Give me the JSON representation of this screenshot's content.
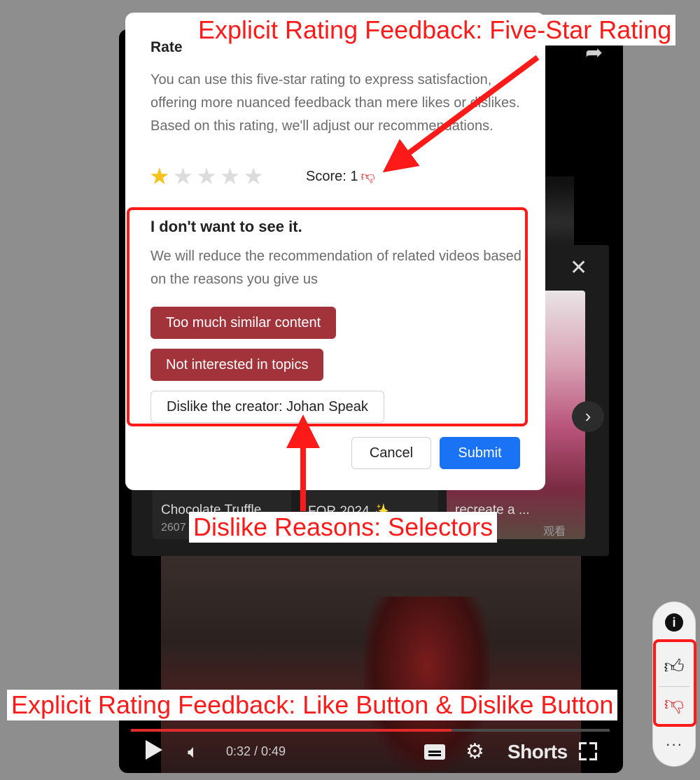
{
  "annotations": {
    "five_star": "Explicit Rating Feedback: Five-Star Rating",
    "dislike_reasons": "Dislike Reasons: Selectors",
    "like_dislike": "Explicit Rating Feedback: Like Button & Dislike Button"
  },
  "rate_section": {
    "title": "Rate",
    "description": "You can use this five-star rating to express satisfaction, offering more nuanced feedback than mere likes or dislikes. Based on this rating, we'll adjust our recommendations.",
    "rating": 1,
    "max_rating": 5,
    "score_label": "Score: 1",
    "score_icon": "thumbs-down-icon"
  },
  "dislike_section": {
    "title": "I don't want to see it.",
    "description": "We will reduce the recommendation of related videos based on the reasons you give us",
    "reasons": [
      {
        "label": "Too much similar content",
        "selected": true
      },
      {
        "label": "Not interested in topics",
        "selected": true
      },
      {
        "label": "Dislike the creator: Johan Speak",
        "selected": false
      }
    ]
  },
  "dialog_actions": {
    "cancel": "Cancel",
    "submit": "Submit"
  },
  "suggestions": [
    {
      "title": "Chocolate Truffle",
      "sub": "2607"
    },
    {
      "title": "FOR 2024 ✨ ...",
      "sub": ""
    },
    {
      "title": "recreate a ...",
      "sub": "观看"
    }
  ],
  "player": {
    "time": "0:32 / 0:49",
    "progress": 0.67,
    "shorts_label": "Shorts"
  },
  "colors": {
    "accent_red": "#ff1a1a",
    "selected_reason": "#a3333a",
    "submit_blue": "#1a73f5",
    "star_gold": "#f6c21c"
  }
}
